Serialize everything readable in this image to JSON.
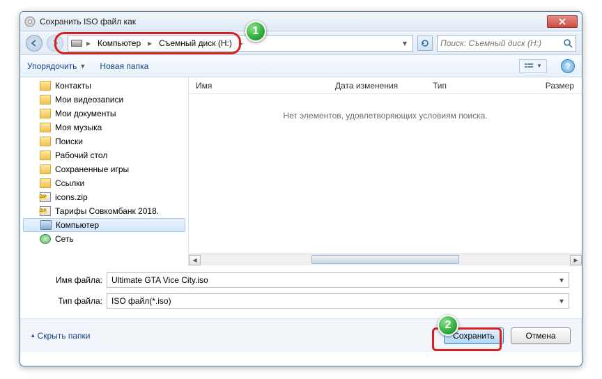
{
  "window": {
    "title": "Сохранить ISO файл как"
  },
  "breadcrumb": {
    "root": "Компьютер",
    "drive": "Съемный диск (H:)"
  },
  "search": {
    "placeholder": "Поиск: Съемный диск (Н:)"
  },
  "toolbar": {
    "organize": "Упорядочить",
    "newfolder": "Новая папка"
  },
  "columns": {
    "name": "Имя",
    "modified": "Дата изменения",
    "type": "Тип",
    "size": "Размер"
  },
  "empty_message": "Нет элементов, удовлетворяющих условиям поиска.",
  "tree": {
    "items": [
      {
        "label": "Контакты",
        "icon": "folder"
      },
      {
        "label": "Мои видеозаписи",
        "icon": "folder"
      },
      {
        "label": "Мои документы",
        "icon": "folder"
      },
      {
        "label": "Моя музыка",
        "icon": "folder"
      },
      {
        "label": "Поиски",
        "icon": "folder"
      },
      {
        "label": "Рабочий стол",
        "icon": "folder"
      },
      {
        "label": "Сохраненные игры",
        "icon": "folder"
      },
      {
        "label": "Ссылки",
        "icon": "folder"
      },
      {
        "label": "icons.zip",
        "icon": "zip"
      },
      {
        "label": "Тарифы Совкомбанк 2018.",
        "icon": "zip"
      },
      {
        "label": "Компьютер",
        "icon": "pc",
        "selected": true
      },
      {
        "label": "Сеть",
        "icon": "net"
      }
    ]
  },
  "form": {
    "filename_label": "Имя файла:",
    "filename_value": "Ultimate GTA Vice City.iso",
    "filetype_label": "Тип файла:",
    "filetype_value": "ISO файл(*.iso)"
  },
  "footer": {
    "hide_folders": "Скрыть папки",
    "save": "Сохранить",
    "cancel": "Отмена"
  },
  "annotations": {
    "badge1": "1",
    "badge2": "2"
  }
}
